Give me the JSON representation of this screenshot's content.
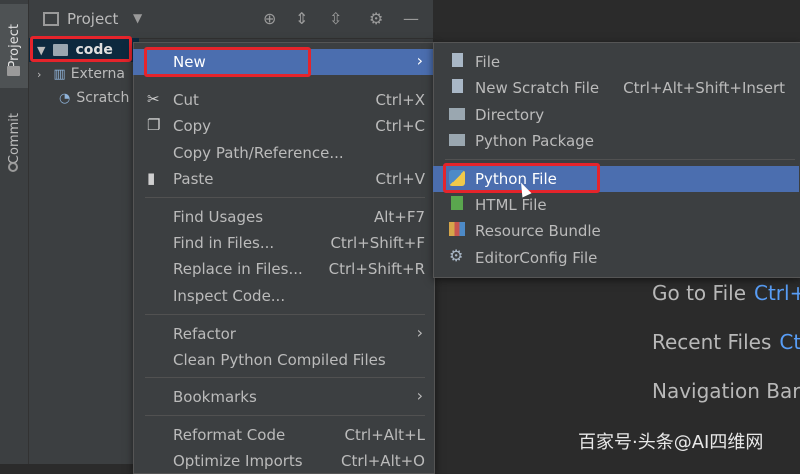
{
  "sidebar": {
    "project_tab": "Project",
    "commit_tab": "Commit"
  },
  "panel": {
    "title": "Project"
  },
  "tree": [
    {
      "label": "code"
    },
    {
      "label": "Externa"
    },
    {
      "label": "Scratch"
    }
  ],
  "menu": {
    "items": [
      {
        "label": "New",
        "shortcut": "",
        "icon": ""
      },
      {
        "label": "Cut",
        "shortcut": "Ctrl+X",
        "icon": "scissors-icon"
      },
      {
        "label": "Copy",
        "shortcut": "Ctrl+C",
        "icon": "copy-icon"
      },
      {
        "label": "Copy Path/Reference...",
        "shortcut": "",
        "icon": ""
      },
      {
        "label": "Paste",
        "shortcut": "Ctrl+V",
        "icon": "clipboard-icon"
      },
      {
        "label": "Find Usages",
        "shortcut": "Alt+F7",
        "icon": ""
      },
      {
        "label": "Find in Files...",
        "shortcut": "Ctrl+Shift+F",
        "icon": ""
      },
      {
        "label": "Replace in Files...",
        "shortcut": "Ctrl+Shift+R",
        "icon": ""
      },
      {
        "label": "Inspect Code...",
        "shortcut": "",
        "icon": ""
      },
      {
        "label": "Refactor",
        "shortcut": "",
        "icon": ""
      },
      {
        "label": "Clean Python Compiled Files",
        "shortcut": "",
        "icon": ""
      },
      {
        "label": "Bookmarks",
        "shortcut": "",
        "icon": ""
      },
      {
        "label": "Reformat Code",
        "shortcut": "Ctrl+Alt+L",
        "icon": ""
      },
      {
        "label": "Optimize Imports",
        "shortcut": "Ctrl+Alt+O",
        "icon": ""
      }
    ]
  },
  "submenu": {
    "items": [
      {
        "label": "File",
        "shortcut": ""
      },
      {
        "label": "New Scratch File",
        "shortcut": "Ctrl+Alt+Shift+Insert"
      },
      {
        "label": "Directory",
        "shortcut": ""
      },
      {
        "label": "Python Package",
        "shortcut": ""
      },
      {
        "label": "Python File",
        "shortcut": ""
      },
      {
        "label": "HTML File",
        "shortcut": ""
      },
      {
        "label": "Resource Bundle",
        "shortcut": ""
      },
      {
        "label": "EditorConfig File",
        "shortcut": ""
      }
    ]
  },
  "editor_hints": [
    {
      "label": "Go to File",
      "key": "Ctrl+"
    },
    {
      "label": "Recent Files",
      "key": "Ct"
    },
    {
      "label": "Navigation Bar",
      "key": ""
    }
  ],
  "watermark": "百家号·头条@AI四维网",
  "colors": {
    "accent": "#4b6eaf",
    "highlight_box": "#e5242b",
    "panel": "#3c3f41",
    "editor": "#2b2b2b"
  }
}
